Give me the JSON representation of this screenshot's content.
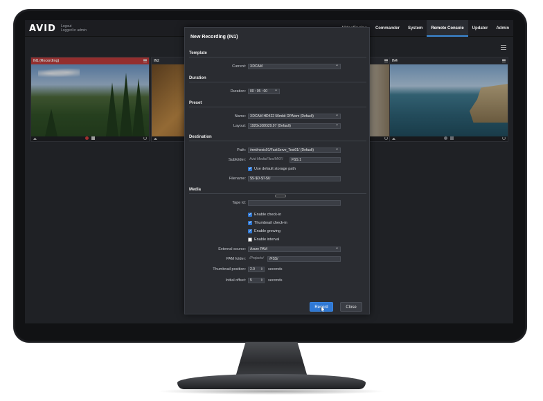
{
  "header": {
    "logo": "AVID",
    "user_line1": "Logout",
    "user_line2": "Logged in admin",
    "nav": [
      {
        "label": "VideoEngine",
        "active": false
      },
      {
        "label": "Commander",
        "active": false
      },
      {
        "label": "System",
        "active": false
      },
      {
        "label": "Remote Console",
        "active": true
      },
      {
        "label": "Updater",
        "active": false
      },
      {
        "label": "Admin",
        "active": false
      }
    ]
  },
  "channels": [
    {
      "label": "IN1 (Recording)",
      "recording": true
    },
    {
      "label": "IN2",
      "recording": false
    },
    {
      "label": "IN4",
      "recording": false
    }
  ],
  "dialog": {
    "title": "New Recording (IN1)",
    "sections": {
      "template": "Template",
      "duration": "Duration",
      "preset": "Preset",
      "destination": "Destination",
      "media": "Media"
    },
    "template": {
      "label": "Current:",
      "value": "XDCAM"
    },
    "duration": {
      "label": "Duration:",
      "value": "00 : 05 : 00"
    },
    "preset": {
      "name_label": "Name:",
      "name_value": "XDCAM HD422 50mbit OPAtom (Default)",
      "layout_label": "Layout:",
      "layout_value": "1920x1080i29.97 (Default)"
    },
    "destination": {
      "path_label": "Path:",
      "path_value": "/mnt/nexis01/FastServe_Test01/ (Default)",
      "subfolder_label": "Subfolder:",
      "subfolder_prefix": "Avid MediaFiles/MXF/",
      "subfolder_value": "FSS.1",
      "default_storage_label": "Use default storage path",
      "filename_label": "Filename:",
      "filename_value": "$S-$D-$T-$U"
    },
    "media": {
      "tape_label": "Tape Id:",
      "tape_value": "",
      "enable_checkin": "Enable check-in",
      "thumbnail_checkin": "Thumbnail check-in",
      "enable_growing": "Enable growing",
      "enable_interval": "Enable interval",
      "external_source_label": "External source:",
      "external_source_value": "Azure PAM",
      "pam_folder_label": "PAM folder:",
      "pam_folder_prefix": "/Projects/",
      "pam_folder_value": "/FSS/",
      "thumbnail_position_label": "Thumbnail position:",
      "thumbnail_position_value": "2.0",
      "initial_offset_label": "Initial offset:",
      "initial_offset_value": "5",
      "unit_seconds": "seconds"
    },
    "buttons": {
      "record": "Record",
      "close": "Close"
    }
  }
}
